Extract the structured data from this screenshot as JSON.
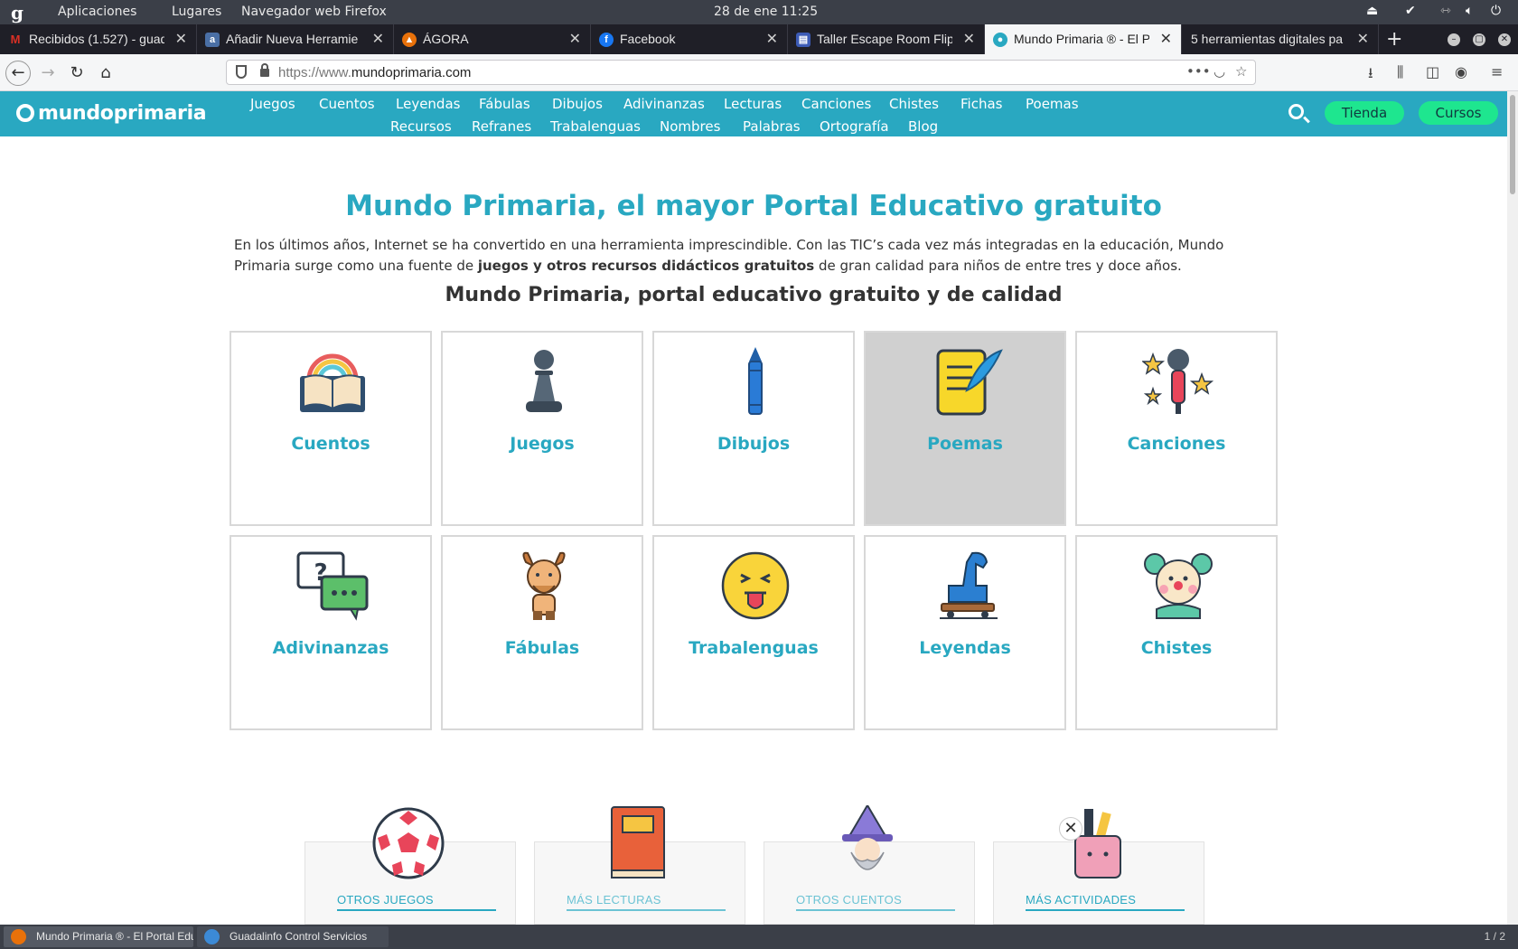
{
  "system_bar": {
    "apps_menu": "Aplicaciones",
    "places_menu": "Lugares",
    "browser_menu": "Navegador web Firefox",
    "clock": "28 de ene  11:25"
  },
  "tabs": [
    {
      "title": "Recibidos (1.527) - guad",
      "favicon": "gmail-icon",
      "color": "#d93025"
    },
    {
      "title": "Añadir Nueva Herramie",
      "favicon": "app-icon",
      "color": "#4a6fa5"
    },
    {
      "title": "ÁGORA",
      "favicon": "agora-icon",
      "color": "#e8710a"
    },
    {
      "title": "Facebook",
      "favicon": "facebook-icon",
      "color": "#1877f2"
    },
    {
      "title": "Taller Escape Room Flip",
      "favicon": "forms-icon",
      "color": "#3c5bb5"
    },
    {
      "title": "Mundo Primaria ® - El P",
      "favicon": "globe-icon",
      "color": "#29a8c1",
      "active": true
    },
    {
      "title": "5 herramientas digitales pa",
      "favicon": "",
      "color": ""
    }
  ],
  "address": {
    "url_prefix": "https://www.",
    "url_domain": "mundoprimaria.com"
  },
  "site": {
    "brand": "mundoprimaria",
    "nav_row1": [
      "Juegos",
      "Cuentos",
      "Leyendas",
      "Fábulas",
      "Dibujos",
      "Adivinanzas",
      "Lecturas",
      "Canciones",
      "Chistes",
      "Fichas",
      "Poemas"
    ],
    "nav_row2": [
      "Recursos",
      "Refranes",
      "Trabalenguas",
      "Nombres",
      "Palabras",
      "Ortografía",
      "Blog"
    ],
    "shop_button": "Tienda",
    "courses_button": "Cursos",
    "accent": "#29a8c1",
    "pill_color": "#1ee68f"
  },
  "content": {
    "title": "Mundo Primaria, el mayor Portal Educativo gratuito",
    "intro_a": "En los últimos años, Internet se ha convertido en una herramienta imprescindible. Con las TIC’s cada vez más integradas en la educación, Mundo Primaria surge como una fuente de ",
    "intro_bold": "juegos y otros recursos didácticos gratuitos",
    "intro_b": " de gran calidad para niños de entre tres y doce años.",
    "subtitle": "Mundo Primaria, portal educativo gratuito y de calidad",
    "cards": [
      {
        "label": "Cuentos",
        "icon": "book-rainbow-icon"
      },
      {
        "label": "Juegos",
        "icon": "chess-pawn-icon"
      },
      {
        "label": "Dibujos",
        "icon": "crayon-icon"
      },
      {
        "label": "Poemas",
        "icon": "scroll-feather-icon",
        "highlighted": true
      },
      {
        "label": "Canciones",
        "icon": "microphone-stars-icon"
      },
      {
        "label": "Adivinanzas",
        "icon": "question-bubbles-icon"
      },
      {
        "label": "Fábulas",
        "icon": "faun-icon"
      },
      {
        "label": "Trabalenguas",
        "icon": "tongue-emoji-icon"
      },
      {
        "label": "Leyendas",
        "icon": "trojan-horse-icon"
      },
      {
        "label": "Chistes",
        "icon": "clown-icon"
      }
    ],
    "bottom": [
      {
        "label": "OTROS JUEGOS",
        "icon": "soccer-ball-icon"
      },
      {
        "label": "MÁS LECTURAS",
        "icon": "red-book-icon"
      },
      {
        "label": "OTROS CUENTOS",
        "icon": "wizard-icon"
      },
      {
        "label": "MÁS ACTIVIDADES",
        "icon": "pencil-cup-icon"
      }
    ]
  },
  "taskbar": {
    "items": [
      "Mundo Primaria ® - El Portal Educ...",
      "Guadalinfo Control Servicios"
    ],
    "pager": "1 / 2"
  }
}
